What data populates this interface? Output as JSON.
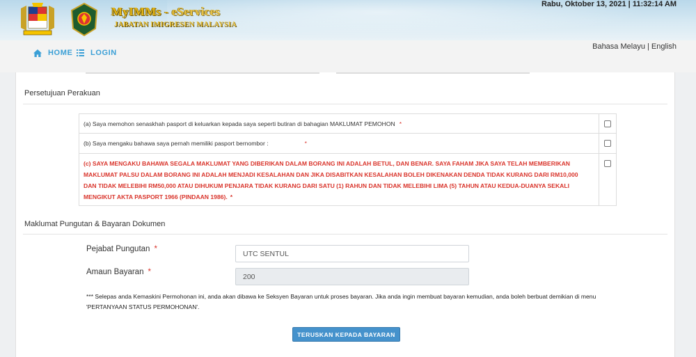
{
  "header": {
    "brand": "MyIMMs - eServices",
    "department": "JABATAN IMIGRESEN MALAYSIA",
    "datetime": "Rabu, Oktober 13, 2021 | 11:32:14 AM"
  },
  "nav": {
    "home": "HOME",
    "login": "LOGIN",
    "lang_malay": "Bahasa Melayu",
    "lang_separator": " | ",
    "lang_english": "English"
  },
  "declaration": {
    "title": "Persetujuan Perakuan",
    "items": [
      {
        "text": "(a) Saya memohon senaskhah pasport di keluarkan kepada saya seperti butiran di bahagian MAKLUMAT PEMOHON",
        "required": "*"
      },
      {
        "text": "(b) Saya mengaku bahawa saya pernah memiliki pasport bernombor :",
        "required": "*"
      },
      {
        "text": "(c) SAYA MENGAKU BAHAWA SEGALA MAKLUMAT YANG DIBERIKAN DALAM BORANG INI ADALAH BETUL, DAN BENAR. SAYA FAHAM JIKA SAYA TELAH MEMBERIKAN MAKLUMAT PALSU DALAM BORANG INI ADALAH MENJADI KESALAHAN DAN JIKA DISABITKAN KESALAHAN BOLEH DIKENAKAN DENDA TIDAK KURANG DARI RM10,000 DAN TIDAK MELEBIHI RM50,000 ATAU DIHUKUM PENJARA TIDAK KURANG DARI SATU (1) RAHUN DAN TIDAK MELEBIHI LIMA (5) TAHUN ATAU KEDUA-DUANYA SEKALI MENGIKUT AKTA PASPORT 1966 (PINDAAN 1986).",
        "required": "*"
      }
    ]
  },
  "payment": {
    "title": "Maklumat Pungutan & Bayaran Dokumen",
    "office_label": "Pejabat Pungutan",
    "office_value": "UTC SENTUL",
    "amount_label": "Amaun Bayaran",
    "amount_value": "200",
    "required": "*",
    "note": "*** Selepas anda Kemaskini Permohonan ini, anda akan dibawa ke Seksyen Bayaran untuk proses bayaran. Jika anda ingin membuat bayaran kemudian, anda boleh berbuat demikian di menu 'PERTANYAAN STATUS PERMOHONAN'.",
    "button": "TERUSKAN KEPADA BAYARAN"
  },
  "colors": {
    "accent": "#3a9fd6",
    "button": "#4592cc",
    "required": "#d9342b",
    "brand_gold": "#e2b419"
  },
  "icons": {
    "home": "home-icon",
    "login": "list-icon"
  }
}
